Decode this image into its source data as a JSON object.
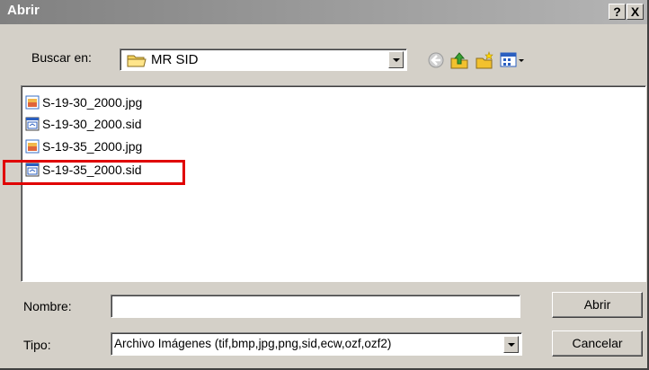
{
  "window": {
    "title": "Abrir",
    "help_label": "?",
    "close_label": "X"
  },
  "lookin": {
    "label": "Buscar en:",
    "value": "MR SID"
  },
  "toolbar": {
    "icons": [
      "back-icon",
      "up-folder-icon",
      "new-folder-icon",
      "view-menu-icon"
    ]
  },
  "files": [
    {
      "name": "S-19-30_2000.jpg",
      "type": "jpg"
    },
    {
      "name": "S-19-30_2000.sid",
      "type": "sid"
    },
    {
      "name": "S-19-35_2000.jpg",
      "type": "jpg"
    },
    {
      "name": "S-19-35_2000.sid",
      "type": "sid",
      "highlighted": true
    }
  ],
  "name_field": {
    "label": "Nombre:",
    "value": ""
  },
  "type_field": {
    "label": "Tipo:",
    "value": "Archivo Imágenes (tif,bmp,jpg,png,sid,ecw,ozf,ozf2)"
  },
  "buttons": {
    "open": "Abrir",
    "cancel": "Cancelar"
  },
  "colors": {
    "highlight": "#e00000",
    "titlebar": "#808080",
    "dialog": "#d4d0c8"
  }
}
